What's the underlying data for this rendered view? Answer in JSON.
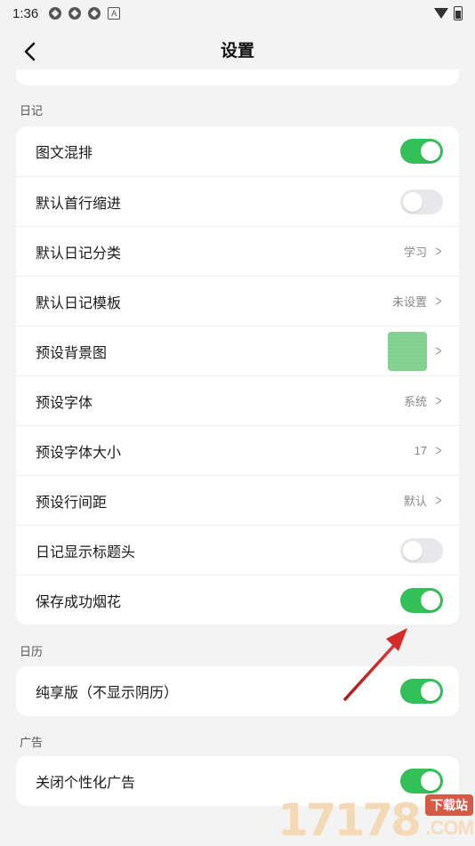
{
  "status_bar": {
    "time": "1:36",
    "notification_icons": [
      "app-icon",
      "app-icon",
      "app-icon",
      "a-icon"
    ]
  },
  "header": {
    "title": "设置"
  },
  "sections": {
    "diary": {
      "label": "日记",
      "rows": [
        {
          "label": "图文混排",
          "type": "toggle",
          "on": true
        },
        {
          "label": "默认首行缩进",
          "type": "toggle",
          "on": false
        },
        {
          "label": "默认日记分类",
          "type": "value",
          "value": "学习"
        },
        {
          "label": "默认日记模板",
          "type": "value",
          "value": "未设置"
        },
        {
          "label": "预设背景图",
          "type": "image"
        },
        {
          "label": "预设字体",
          "type": "value",
          "value": "系统"
        },
        {
          "label": "预设字体大小",
          "type": "value",
          "value": "17"
        },
        {
          "label": "预设行间距",
          "type": "value",
          "value": "默认"
        },
        {
          "label": "日记显示标题头",
          "type": "toggle",
          "on": false
        },
        {
          "label": "保存成功烟花",
          "type": "toggle",
          "on": true
        }
      ]
    },
    "calendar": {
      "label": "日历",
      "rows": [
        {
          "label": "纯享版（不显示阴历）",
          "type": "toggle",
          "on": true
        }
      ]
    },
    "ads": {
      "label": "广告",
      "rows": [
        {
          "label": "关闭个性化广告",
          "type": "toggle",
          "on": true
        }
      ]
    }
  },
  "colors": {
    "toggle_on": "#33c059",
    "toggle_off": "#e8e8ea",
    "annotation_arrow": "#d42a2a"
  },
  "watermark": {
    "digits": "17178",
    "tag": "下载站",
    "domain": ".COM"
  }
}
